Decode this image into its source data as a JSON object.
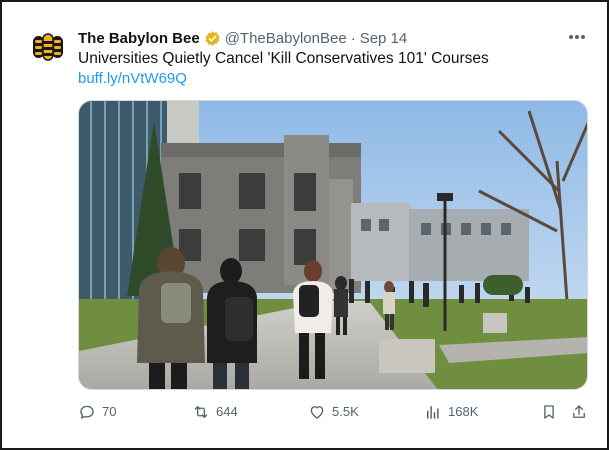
{
  "tweet": {
    "display_name": "The Babylon Bee",
    "handle": "@TheBabylonBee",
    "separator": "·",
    "date": "Sep 14",
    "text": "Universities Quietly Cancel 'Kill Conservatives 101' Courses",
    "link": "buff.ly/nVtW69Q"
  },
  "actions": {
    "replies": "70",
    "retweets": "644",
    "likes": "5.5K",
    "views": "168K"
  },
  "colors": {
    "verified": "#e2b719",
    "link": "#1d9bf0",
    "muted": "#536471",
    "brand": "#1a1a1a"
  },
  "icons": {
    "avatar": "babylon-bee-logo",
    "verified": "verified-badge-icon",
    "more": "more-horizontal-icon",
    "reply": "reply-icon",
    "retweet": "retweet-icon",
    "like": "heart-icon",
    "views": "views-icon",
    "bookmark": "bookmark-icon",
    "share": "share-icon"
  }
}
